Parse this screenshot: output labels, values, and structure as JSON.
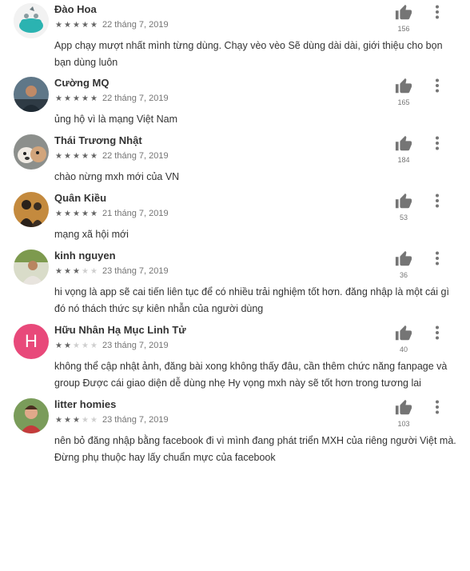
{
  "reviews": [
    {
      "name": "Đào Hoa",
      "rating": 5,
      "date": "22 tháng 7, 2019",
      "likes": "156",
      "text": "App chạy mượt nhất mình từng dùng. Chạy vèo vèo Sẽ dùng dài dài, giới thiệu cho bọn bạn dùng luôn",
      "avatar": "teal-cartoon-avatar"
    },
    {
      "name": "Cường MQ",
      "rating": 5,
      "date": "22 tháng 7, 2019",
      "likes": "165",
      "text": "ủng hộ vì là mạng Việt Nam",
      "avatar": "photo-avatar"
    },
    {
      "name": "Thái Trương Nhật",
      "rating": 5,
      "date": "22 tháng 7, 2019",
      "likes": "184",
      "text": "chào nừng mxh mới của VN",
      "avatar": "dog-photo-avatar"
    },
    {
      "name": "Quân Kiều",
      "rating": 5,
      "date": "21 tháng 7, 2019",
      "likes": "53",
      "text": "mạng xã hội mới",
      "avatar": "silhouette-avatar"
    },
    {
      "name": "kinh nguyen",
      "rating": 3,
      "date": "23 tháng 7, 2019",
      "likes": "36",
      "text": "hi vọng là app sẽ cai tiến liên tục để có nhiều trải nghiệm tốt hơn. đăng nhập là một cái gì đó nó thách thức sự kiên nhẫn của người dùng",
      "avatar": "photo-avatar"
    },
    {
      "name": "Hữu Nhân Hạ Mục Linh Tử",
      "rating": 2,
      "date": "23 tháng 7, 2019",
      "likes": "40",
      "text": "không thể cập nhật ảnh, đăng bài xong không thấy đâu, cần thêm chức năng fanpage và group Được cái giao diện dễ dùng nhẹ Hy vọng mxh này sẽ tốt hơn trong tương lai",
      "avatar_letter": "H"
    },
    {
      "name": "litter homies",
      "rating": 3,
      "date": "23 tháng 7, 2019",
      "likes": "103",
      "text": "nên bỏ đăng nhập bằng facebook đi vì mình đang phát triển MXH của riêng người Việt mà. Đừng phụ thuộc hay lấy chuẩn mực của facebook",
      "avatar": "child-photo-avatar"
    }
  ],
  "colors": {
    "letter_avatar": "#e8497a",
    "star_on": "#656565",
    "star_off": "#cfcfcf",
    "meta_text": "#757575"
  },
  "icons": {
    "like": "thumbs-up-icon",
    "menu": "more-vert-icon",
    "rating": "star-icon"
  }
}
